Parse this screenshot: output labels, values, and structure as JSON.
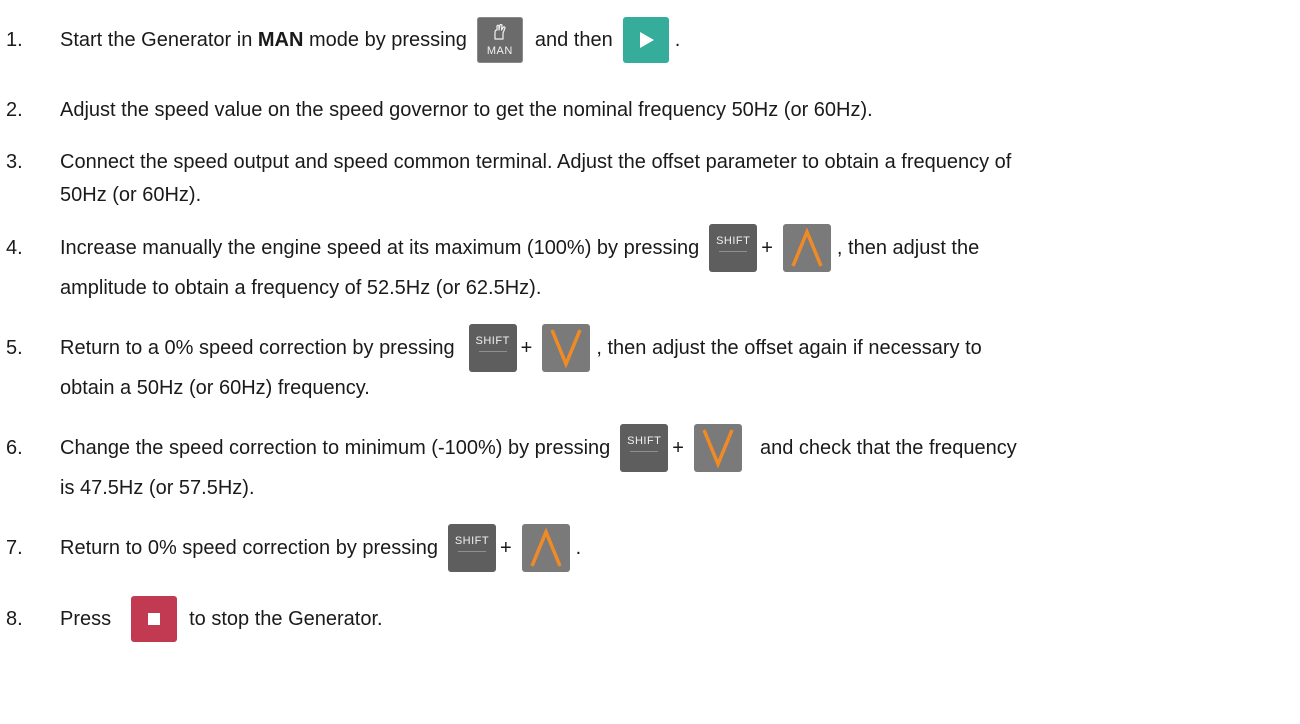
{
  "steps": [
    {
      "number": "1.",
      "lines": [
        {
          "parts": [
            "Start the Generator in ",
            "MAN",
            " mode by pressing",
            "and then",
            "."
          ]
        }
      ]
    },
    {
      "number": "2.",
      "lines": [
        {
          "parts": [
            "Adjust the speed value on the speed governor to get the nominal frequency 50Hz (or 60Hz)."
          ]
        }
      ]
    },
    {
      "number": "3.",
      "lines": [
        {
          "parts": [
            "Connect the speed output and speed common terminal. Adjust the offset parameter to obtain a frequency of"
          ]
        },
        {
          "parts": [
            "50Hz (or 60Hz)."
          ]
        }
      ]
    },
    {
      "number": "4.",
      "lines": [
        {
          "parts": [
            "Increase manually the engine speed at its maximum (100%) by pressing",
            "+",
            ", then adjust the"
          ]
        },
        {
          "parts": [
            "amplitude to obtain a frequency of 52.5Hz (or 62.5Hz)."
          ]
        }
      ]
    },
    {
      "number": "5.",
      "lines": [
        {
          "parts": [
            "Return to a 0% speed correction by pressing",
            "+",
            ", then adjust the offset again if necessary to"
          ]
        },
        {
          "parts": [
            "obtain a 50Hz (or 60Hz) frequency."
          ]
        }
      ]
    },
    {
      "number": "6.",
      "lines": [
        {
          "parts": [
            "Change the speed correction to minimum (-100%) by pressing",
            "+",
            "and check that the frequency"
          ]
        },
        {
          "parts": [
            "is 47.5Hz (or 57.5Hz)."
          ]
        }
      ]
    },
    {
      "number": "7.",
      "lines": [
        {
          "parts": [
            "Return to 0% speed correction by pressing",
            "+",
            "."
          ]
        }
      ]
    },
    {
      "number": "8.",
      "lines": [
        {
          "parts": [
            "Press",
            "to stop the Generator."
          ]
        }
      ]
    }
  ],
  "keys": {
    "man": {
      "label": "MAN",
      "icon": "hand-icon",
      "color": "#6b6b6b"
    },
    "start": {
      "icon": "play-icon",
      "color": "#35ad9a"
    },
    "shift": {
      "label": "SHIFT",
      "color": "#5e5e5e"
    },
    "up": {
      "icon": "chevron-up-icon",
      "color": "#7a7a7a",
      "stroke": "#f08a24"
    },
    "down": {
      "icon": "chevron-down-icon",
      "color": "#7a7a7a",
      "stroke": "#f08a24"
    },
    "stop": {
      "icon": "stop-icon",
      "color": "#c23a52"
    }
  }
}
